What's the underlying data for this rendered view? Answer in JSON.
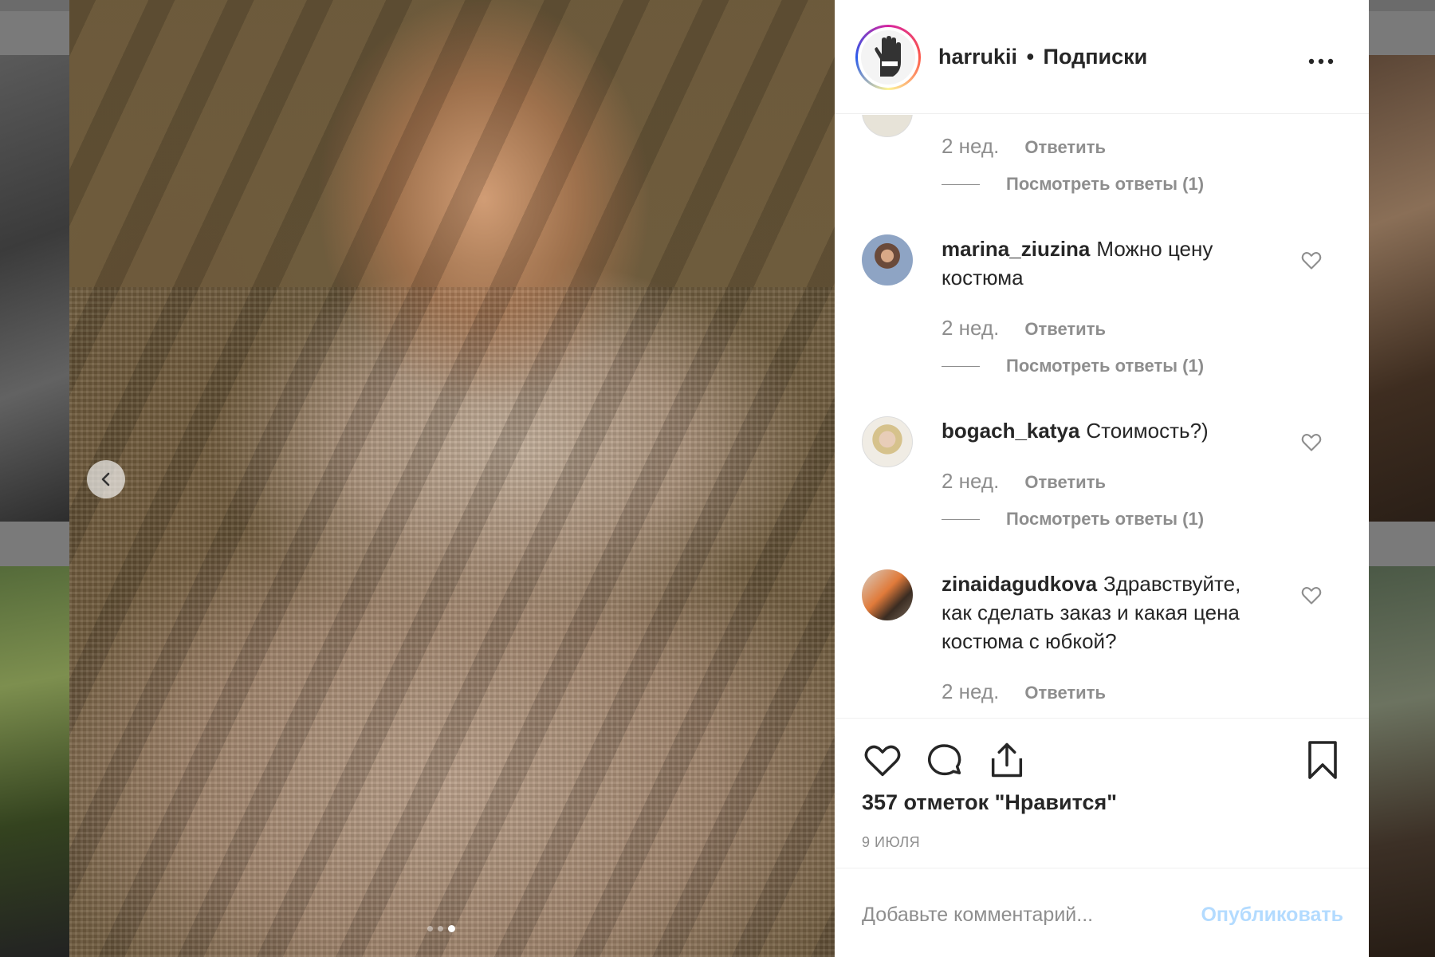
{
  "header": {
    "username": "harrukii",
    "separator": "•",
    "follow_status": "Подписки",
    "more_label": "•••"
  },
  "comments": {
    "partial": {
      "time": "2 нед.",
      "reply_label": "Ответить",
      "view_replies": "Посмотреть ответы (1)"
    },
    "items": [
      {
        "username": "marina_ziuzina",
        "text": "Можно цену костюма",
        "time": "2 нед.",
        "reply_label": "Ответить",
        "view_replies": "Посмотреть ответы (1)"
      },
      {
        "username": "bogach_katya",
        "text": "Стоимость?)",
        "time": "2 нед.",
        "reply_label": "Ответить",
        "view_replies": "Посмотреть ответы (1)"
      },
      {
        "username": "zinaidagudkova",
        "text": "Здравствуйте, как сделать заказ и какая цена костюма с юбкой?",
        "time": "2 нед.",
        "reply_label": "Ответить"
      }
    ]
  },
  "actions": {
    "likes": "357 отметок \"Нравится\"",
    "date": "9 ИЮЛЯ"
  },
  "comment_box": {
    "placeholder": "Добавьте комментарий...",
    "publish_label": "Опубликовать"
  },
  "carousel": {
    "total": 3,
    "active": 3
  },
  "icons": {
    "prev": "chevron-left-icon",
    "more": "more-horizontal-icon",
    "like": "heart-icon",
    "comment": "comment-bubble-icon",
    "share": "share-upload-icon",
    "save": "bookmark-icon"
  },
  "colors": {
    "text": "#262626",
    "muted": "#8e8e8e",
    "publish_disabled": "#b3dbff"
  }
}
